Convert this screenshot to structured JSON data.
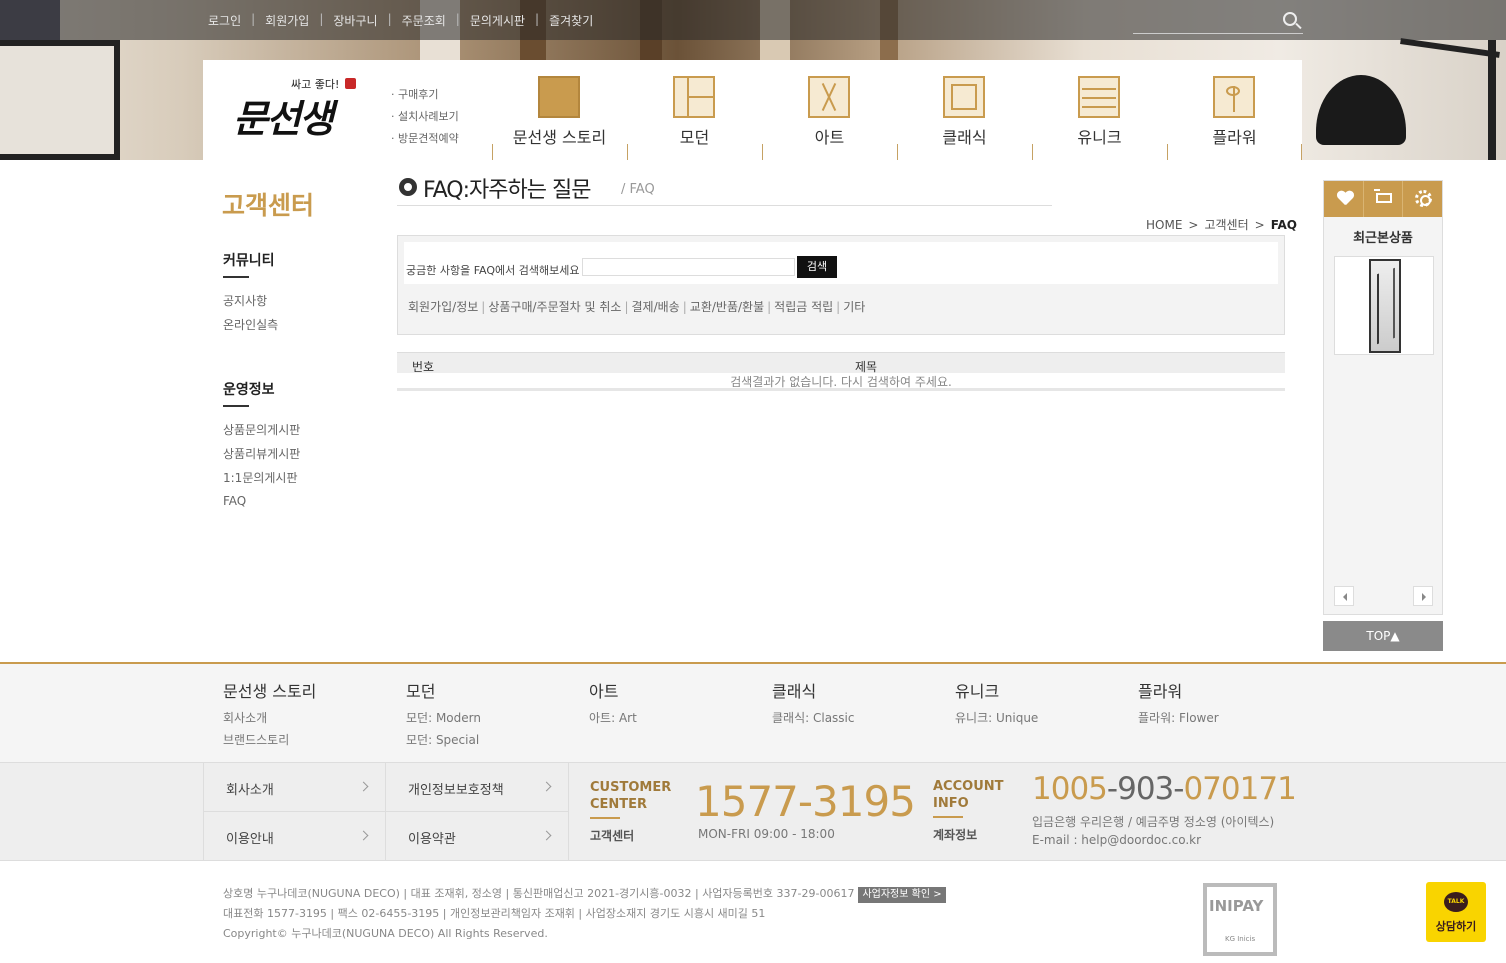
{
  "topbar": {
    "links": [
      "로그인",
      "회원가입",
      "장바구니",
      "주문조회",
      "문의게시판",
      "즐겨찾기"
    ]
  },
  "logo": {
    "tagline": "싸고 좋다!",
    "name": "문선생"
  },
  "quicklinks": [
    "· 구매후기",
    "· 설치사례보기",
    "· 방문견적예약"
  ],
  "menu": [
    {
      "label": "문선생 스토리",
      "icon": "door-story-icon"
    },
    {
      "label": "모던",
      "icon": "modern-door-icon"
    },
    {
      "label": "아트",
      "icon": "art-door-icon"
    },
    {
      "label": "클래식",
      "icon": "classic-door-icon"
    },
    {
      "label": "유니크",
      "icon": "unique-door-icon"
    },
    {
      "label": "플라워",
      "icon": "flower-door-icon"
    }
  ],
  "sidebar": {
    "title": "고객센터",
    "groups": [
      {
        "heading": "커뮤니티",
        "items": [
          "공지사항",
          "온라인실측"
        ]
      },
      {
        "heading": "운영정보",
        "items": [
          "상품문의게시판",
          "상품리뷰게시판",
          "1:1문의게시판",
          "FAQ"
        ]
      }
    ]
  },
  "main": {
    "title": "FAQ:자주하는 질문",
    "subtitle": "/ FAQ",
    "breadcrumb": {
      "home": "HOME",
      "section": "고객센터",
      "current": "FAQ",
      "sep": ">"
    },
    "search": {
      "prompt": "궁금한 사항을 FAQ에서 검색해보세요",
      "value": "",
      "button": "검색"
    },
    "categories": [
      "회원가입/정보",
      "상품구매/주문절차 및 취소",
      "결제/배송",
      "교환/반품/환불",
      "적립금 적립",
      "기타"
    ],
    "table": {
      "col_no": "번호",
      "col_title": "제목",
      "empty": "검색결과가 없습니다. 다시 검색하여 주세요."
    }
  },
  "quickbar": {
    "title": "최근본상품",
    "top_label": "TOP▲"
  },
  "footer": {
    "columns": [
      {
        "heading": "문선생 스토리",
        "links": [
          "회사소개",
          "브랜드스토리"
        ]
      },
      {
        "heading": "모던",
        "links": [
          "모던: Modern",
          "모던: Special"
        ]
      },
      {
        "heading": "아트",
        "links": [
          "아트: Art"
        ]
      },
      {
        "heading": "클래식",
        "links": [
          "클래식: Classic"
        ]
      },
      {
        "heading": "유니크",
        "links": [
          "유니크: Unique"
        ]
      },
      {
        "heading": "플라워",
        "links": [
          "플라워: Flower"
        ]
      }
    ],
    "info_links": [
      "회사소개",
      "개인정보보호정책",
      "이용안내",
      "이용약관"
    ],
    "customer_center": {
      "label_line1": "CUSTOMER",
      "label_line2": "CENTER",
      "sub": "고객센터",
      "phone": "1577-3195",
      "hours": "MON-FRI 09:00 - 18:00"
    },
    "account": {
      "label_line1": "ACCOUNT",
      "label_line2": "INFO",
      "sub": "계좌정보",
      "p1": "1005",
      "p2": "-903-",
      "p3": "070171",
      "bank": "입금은행 우리은행 / 예금주명 정소영 (아이텍스)",
      "email": "E-mail : help@doordoc.co.kr"
    },
    "biz_line1": "상호명 누구나데코(NUGUNA DECO) | 대표 조재휘, 정소영 | 통신판매업신고 2021-경기시흥-0032 | 사업자등록번호 337-29-00617",
    "biz_button": "사업자정보 확인 >",
    "biz_line2": "대표전화 1577-3195 | 팩스 02-6455-3195 | 개인정보관리책임자 조재휘 | 사업장소재지 경기도 시흥시 새미길 51",
    "copyright": "Copyright© 누구나데코(NUGUNA DECO) All Rights Reserved.",
    "inipay": {
      "big": "INIPAY",
      "small": "KG Inicis"
    },
    "kakao": {
      "bubble": "TALK",
      "label": "상담하기"
    }
  }
}
